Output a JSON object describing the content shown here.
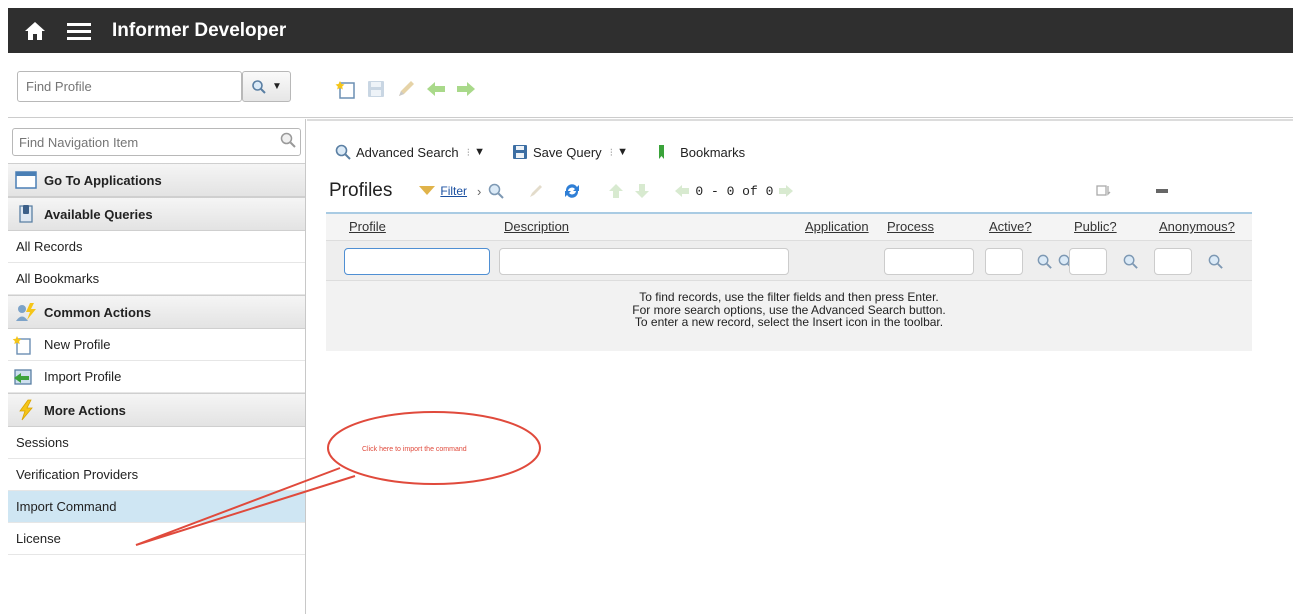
{
  "header": {
    "title": "Informer Developer"
  },
  "profile_search": {
    "placeholder": "Find Profile"
  },
  "sidebar": {
    "search_placeholder": "Find Navigation Item",
    "go_to_applications": "Go To Applications",
    "available_queries": "Available Queries",
    "queries": [
      "All Records",
      "All Bookmarks"
    ],
    "common_actions": "Common Actions",
    "common_items": [
      "New Profile",
      "Import Profile"
    ],
    "more_actions": "More Actions",
    "more_items": [
      "Sessions",
      "Verification Providers",
      "Import Command",
      "License"
    ]
  },
  "query_bar": {
    "advanced_search": "Advanced Search",
    "save_query": "Save Query",
    "bookmarks": "Bookmarks"
  },
  "page": {
    "heading": "Profiles",
    "filter": "Filter",
    "pager": "0 - 0 of 0"
  },
  "grid": {
    "columns": [
      "Profile",
      "Description",
      "Application",
      "Process",
      "Active?",
      "Public?",
      "Anonymous?"
    ],
    "message_lines": [
      "To find records, use the filter fields and then press Enter.",
      "For more search options, use the Advanced Search button.",
      "To enter a new record, select the Insert icon in the toolbar."
    ]
  },
  "annotation": {
    "text": "Click here to import the command"
  },
  "colors": {
    "header_bg": "#2f2f2f",
    "selected_row": "#cfe6f3",
    "callout": "#e04a3c",
    "grid_accent": "#a9cbe3"
  }
}
